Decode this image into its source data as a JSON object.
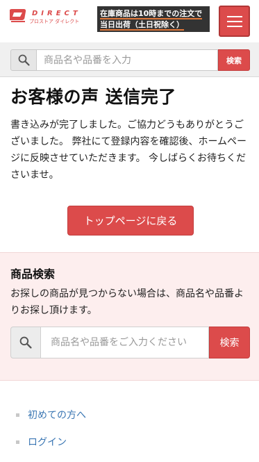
{
  "header": {
    "logo": {
      "wordmark": "DIRECT",
      "subtitle": "プロストア ダイレクト",
      "brand_color": "#dc4b4b"
    },
    "notice": {
      "line1": "在庫商品は10時までの注文で",
      "line2": "当日出荷（土日祝除く）"
    },
    "menu_icon": "hamburger-icon"
  },
  "top_search": {
    "icon": "search-icon",
    "placeholder": "商品名や品番を入力",
    "button_label": "検索"
  },
  "main": {
    "title": "お客様の声 送信完了",
    "message": "書き込みが完了しました。ご協力どうもありがとうございました。 弊社にて登録内容を確認後、ホームページに反映させていただきます。 今しばらくお待ちくださいませ。",
    "home_button_label": "トップページに戻る"
  },
  "product_search": {
    "title": "商品検索",
    "description": "お探しの商品が見つからない場合は、商品名や品番よりお探し頂けます。",
    "icon": "search-icon",
    "placeholder": "商品名や品番をご入力ください",
    "button_label": "検索"
  },
  "footer_links": [
    {
      "label": "初めての方へ"
    },
    {
      "label": "ログイン"
    }
  ],
  "colors": {
    "accent": "#dc4b4b",
    "section_bg": "#fdeeee",
    "link": "#3a76b3",
    "notice_bg": "#333333"
  }
}
